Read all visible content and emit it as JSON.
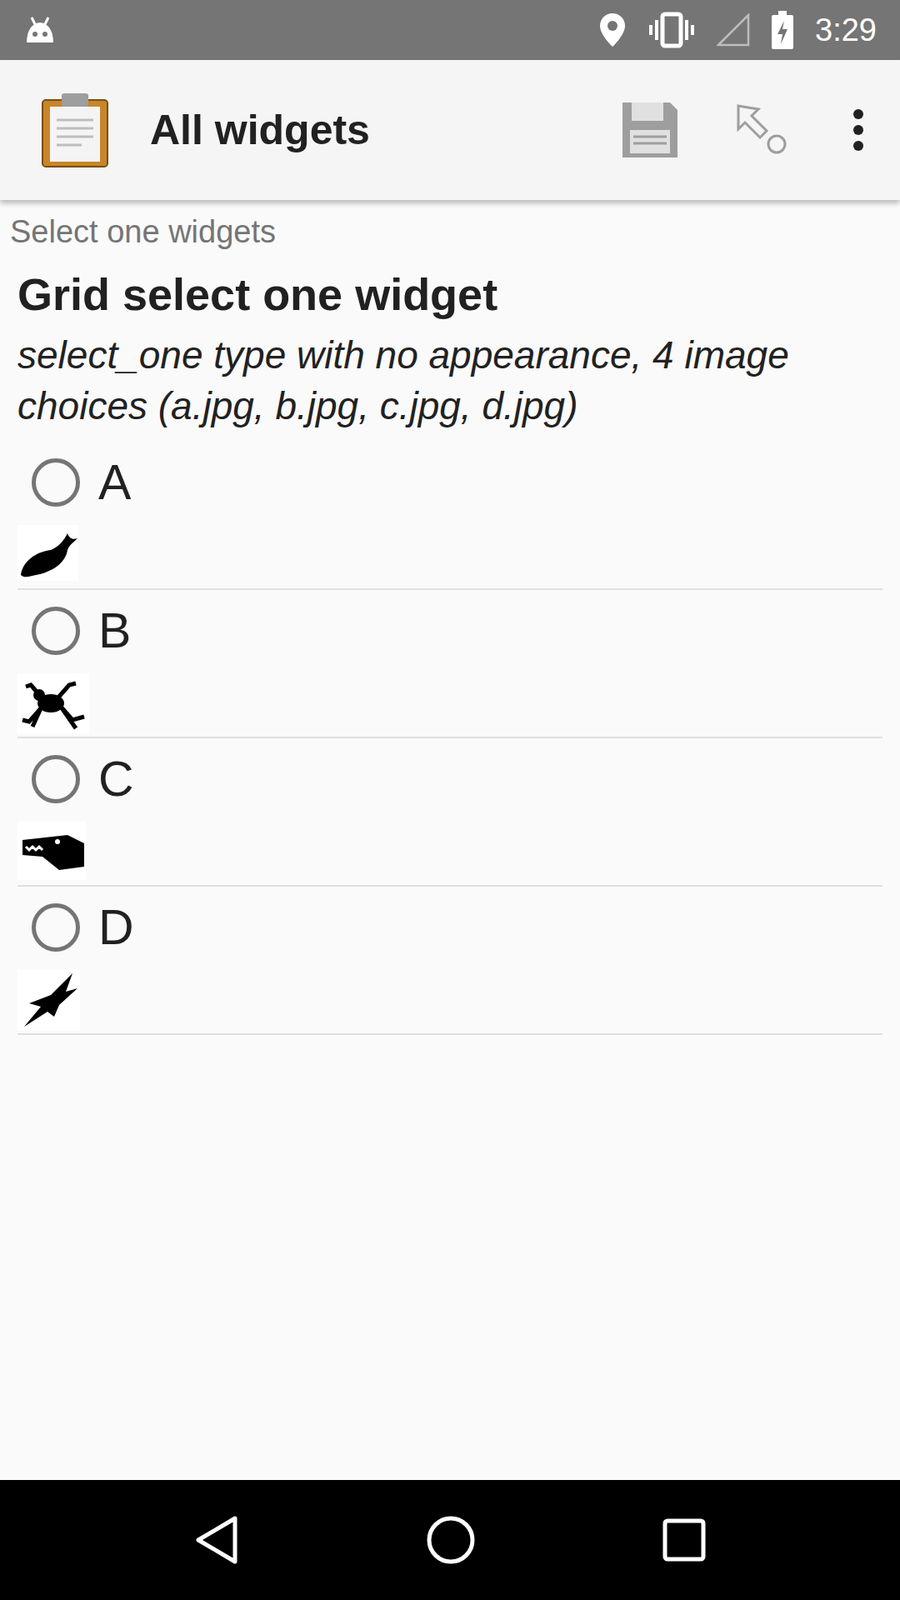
{
  "status_bar": {
    "time": "3:29"
  },
  "toolbar": {
    "title": "All widgets"
  },
  "group": {
    "label": "Select one widgets"
  },
  "question": {
    "label": "Grid select one widget",
    "hint": "select_one type with no appearance, 4 image choices (a.jpg, b.jpg, c.jpg, d.jpg)",
    "choices": [
      {
        "label": "A",
        "selected": false
      },
      {
        "label": "B",
        "selected": false
      },
      {
        "label": "C",
        "selected": false
      },
      {
        "label": "D",
        "selected": false
      }
    ]
  }
}
